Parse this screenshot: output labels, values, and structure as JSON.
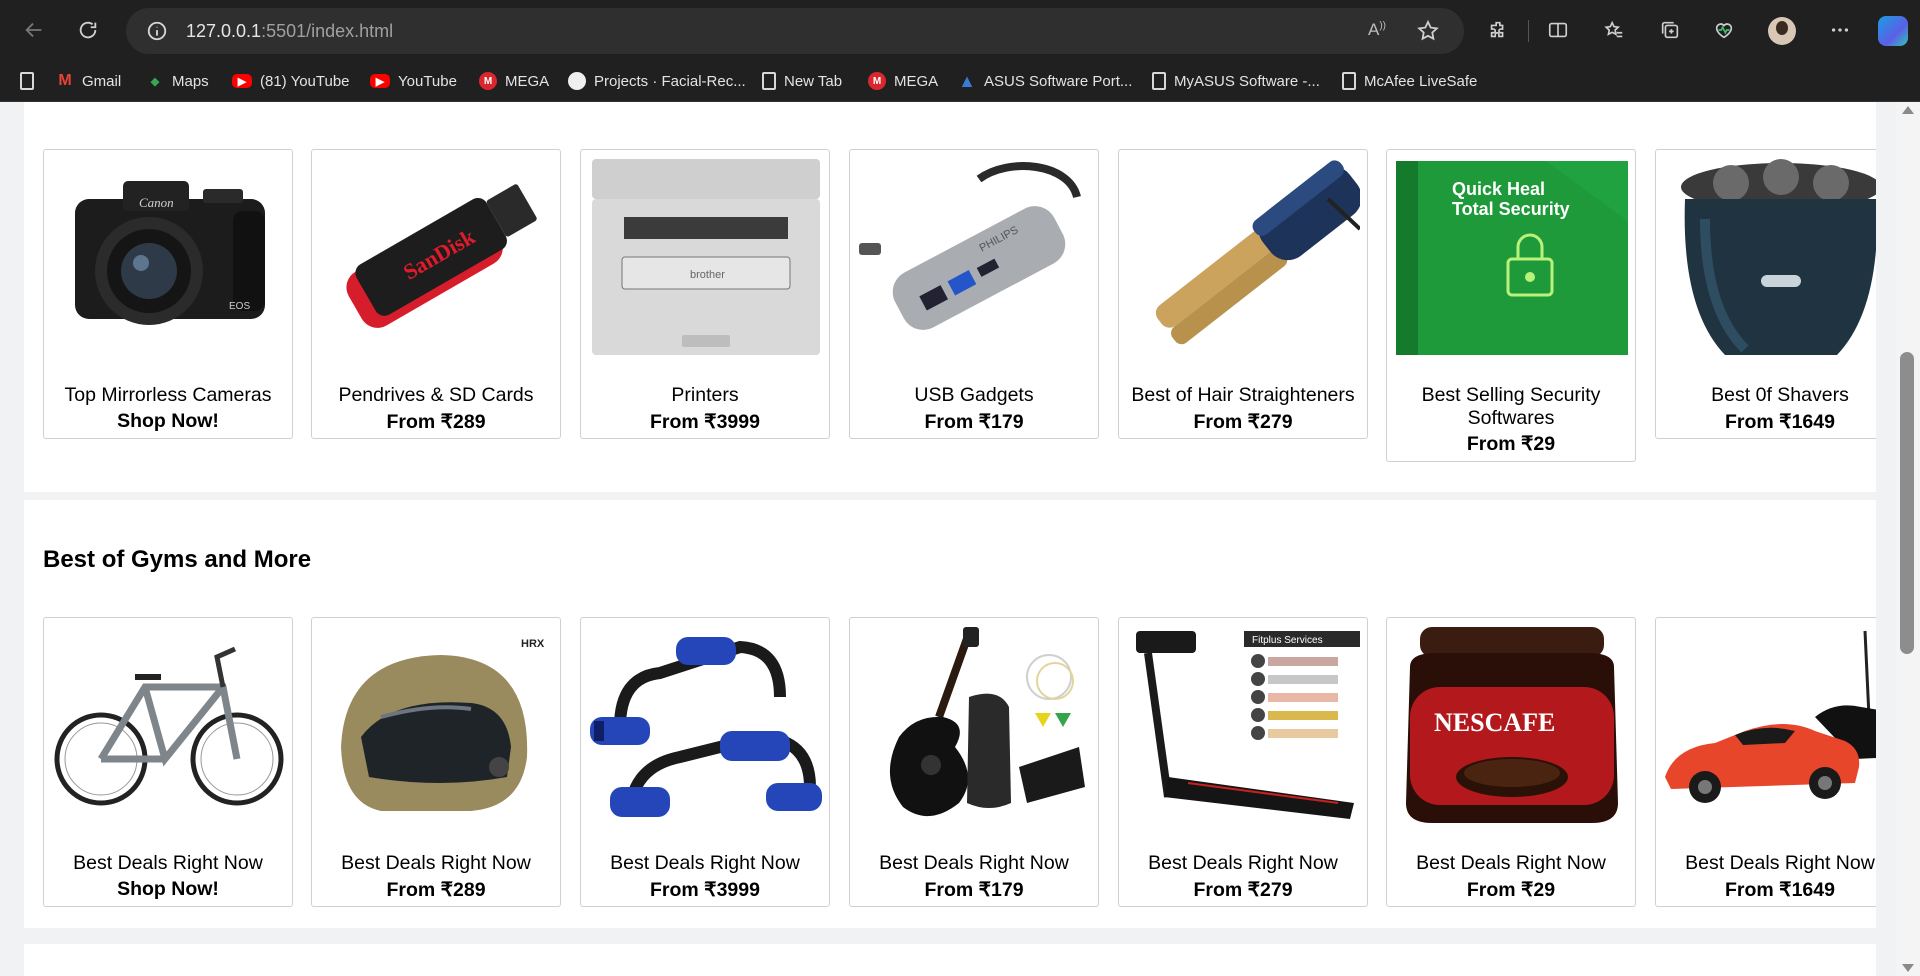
{
  "browser": {
    "url_host": "127.0.0.1",
    "url_rest": ":5501/index.html",
    "read_aloud_label": "A",
    "bookmarks": [
      {
        "label": "",
        "icon": "page-icon"
      },
      {
        "label": "Gmail",
        "icon": "gmail-icon"
      },
      {
        "label": "Maps",
        "icon": "maps-icon"
      },
      {
        "label": "(81) YouTube",
        "icon": "youtube-icon"
      },
      {
        "label": "YouTube",
        "icon": "youtube-icon"
      },
      {
        "label": "MEGA",
        "icon": "mega-icon"
      },
      {
        "label": "Projects · Facial-Rec...",
        "icon": "github-icon"
      },
      {
        "label": "New Tab",
        "icon": "page-icon"
      },
      {
        "label": "MEGA",
        "icon": "mega-icon"
      },
      {
        "label": "ASUS Software Port...",
        "icon": "asus-icon"
      },
      {
        "label": "MyASUS Software -...",
        "icon": "page-icon"
      },
      {
        "label": "McAfee LiveSafe",
        "icon": "page-icon"
      }
    ]
  },
  "sections": {
    "electronics": {
      "cards": [
        {
          "name": "Top Mirrorless Cameras",
          "price": "Shop Now!",
          "image": "camera"
        },
        {
          "name": "Pendrives & SD Cards",
          "price": "From ₹289",
          "image": "pendrive"
        },
        {
          "name": "Printers",
          "price": "From ₹3999",
          "image": "printer"
        },
        {
          "name": "USB Gadgets",
          "price": "From ₹179",
          "image": "usb-hub"
        },
        {
          "name": "Best of Hair Straighteners",
          "price": "From ₹279",
          "image": "hair-straightener"
        },
        {
          "name": "Best Selling Security Softwares",
          "price": "From ₹29",
          "image": "security-software"
        },
        {
          "name": "Best 0f Shavers",
          "price": "From ₹1649",
          "image": "shaver"
        }
      ],
      "security_box_text": [
        "Quick Heal",
        "Total Security"
      ]
    },
    "gyms": {
      "title": "Best of Gyms and More",
      "cards": [
        {
          "name": "Best Deals Right Now",
          "price": "Shop Now!",
          "image": "bicycle"
        },
        {
          "name": "Best Deals Right Now",
          "price": "From ₹289",
          "image": "helmet"
        },
        {
          "name": "Best Deals Right Now",
          "price": "From ₹3999",
          "image": "pushup-bars"
        },
        {
          "name": "Best Deals Right Now",
          "price": "From ₹179",
          "image": "guitar"
        },
        {
          "name": "Best Deals Right Now",
          "price": "From ₹279",
          "image": "treadmill"
        },
        {
          "name": "Best Deals Right Now",
          "price": "From ₹29",
          "image": "coffee-jar"
        },
        {
          "name": "Best Deals Right Now",
          "price": "From ₹1649",
          "image": "rc-car"
        }
      ],
      "coffee_label": "NESCAFE",
      "treadmill_label": "Fitplus Services"
    }
  },
  "colors": {
    "page_bg": "#f1f2f4",
    "card_border": "#d0d0d0",
    "chrome_bg": "#202020",
    "address_bg": "#2f2f2f"
  }
}
